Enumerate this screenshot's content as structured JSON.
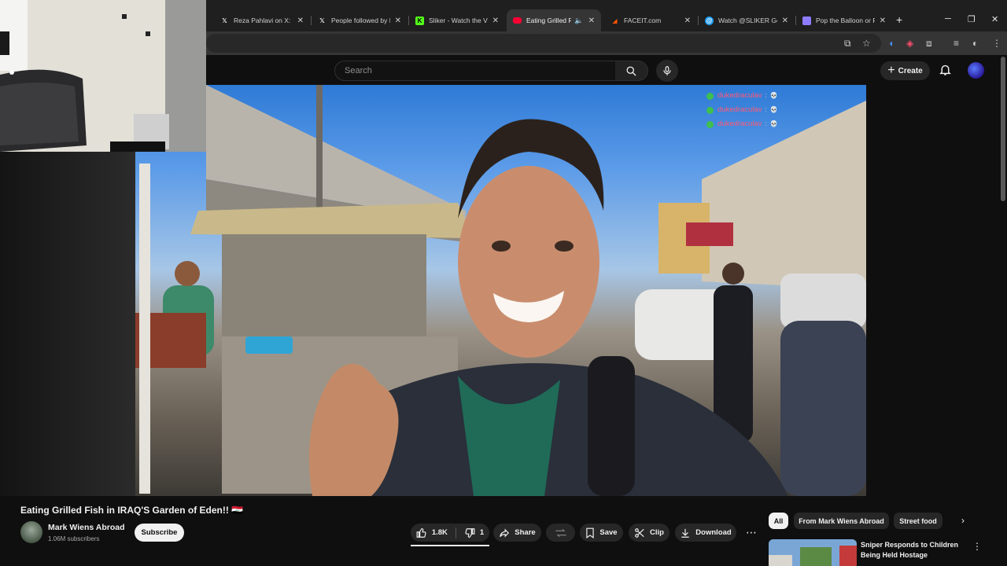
{
  "browser": {
    "tabs": [
      {
        "title": "Reza Pahlavi on X: \"M",
        "favicon": "x-logo"
      },
      {
        "title": "People followed by R",
        "favicon": "x-logo"
      },
      {
        "title": "Sliker - Watch the VO",
        "favicon": "kick-logo"
      },
      {
        "title": "Eating Grilled Fish",
        "favicon": "youtube-logo",
        "active": true
      },
      {
        "title": "FACEIT.com",
        "favicon": "faceit-logo"
      },
      {
        "title": "Watch @SLIKER Get a",
        "favicon": "tweetdeck-logo"
      },
      {
        "title": "Pop the Balloon or Fi",
        "favicon": "generic-logo"
      }
    ],
    "new_tab_label": "+"
  },
  "youtube": {
    "search": {
      "placeholder": "Search"
    },
    "create_label": "Create",
    "chat_overlay": [
      {
        "user": "dukedraculav",
        "sep": ":"
      },
      {
        "user": "dukedraculav",
        "sep": ":"
      },
      {
        "user": "dukedraculav",
        "sep": ":"
      }
    ],
    "video": {
      "title": "Eating Grilled Fish in IRAQ'S Garden of Eden!! 🇮🇶",
      "channel": "Mark Wiens Abroad",
      "subscribers": "1.06M subscribers",
      "subscribe_label": "Subscribe",
      "likes": "1.8K",
      "dislikes": "1",
      "share_label": "Share",
      "save_label": "Save",
      "clip_label": "Clip",
      "download_label": "Download"
    },
    "chips": [
      "All",
      "From Mark Wiens Abroad",
      "Street food"
    ],
    "recommendation": {
      "title": "Sniper Responds to Children Being Held Hostage"
    }
  },
  "colors": {
    "background": "#0f0f0f",
    "pill": "#272727",
    "chat_name": "#ff5a78",
    "accent_red": "#ff0033"
  }
}
